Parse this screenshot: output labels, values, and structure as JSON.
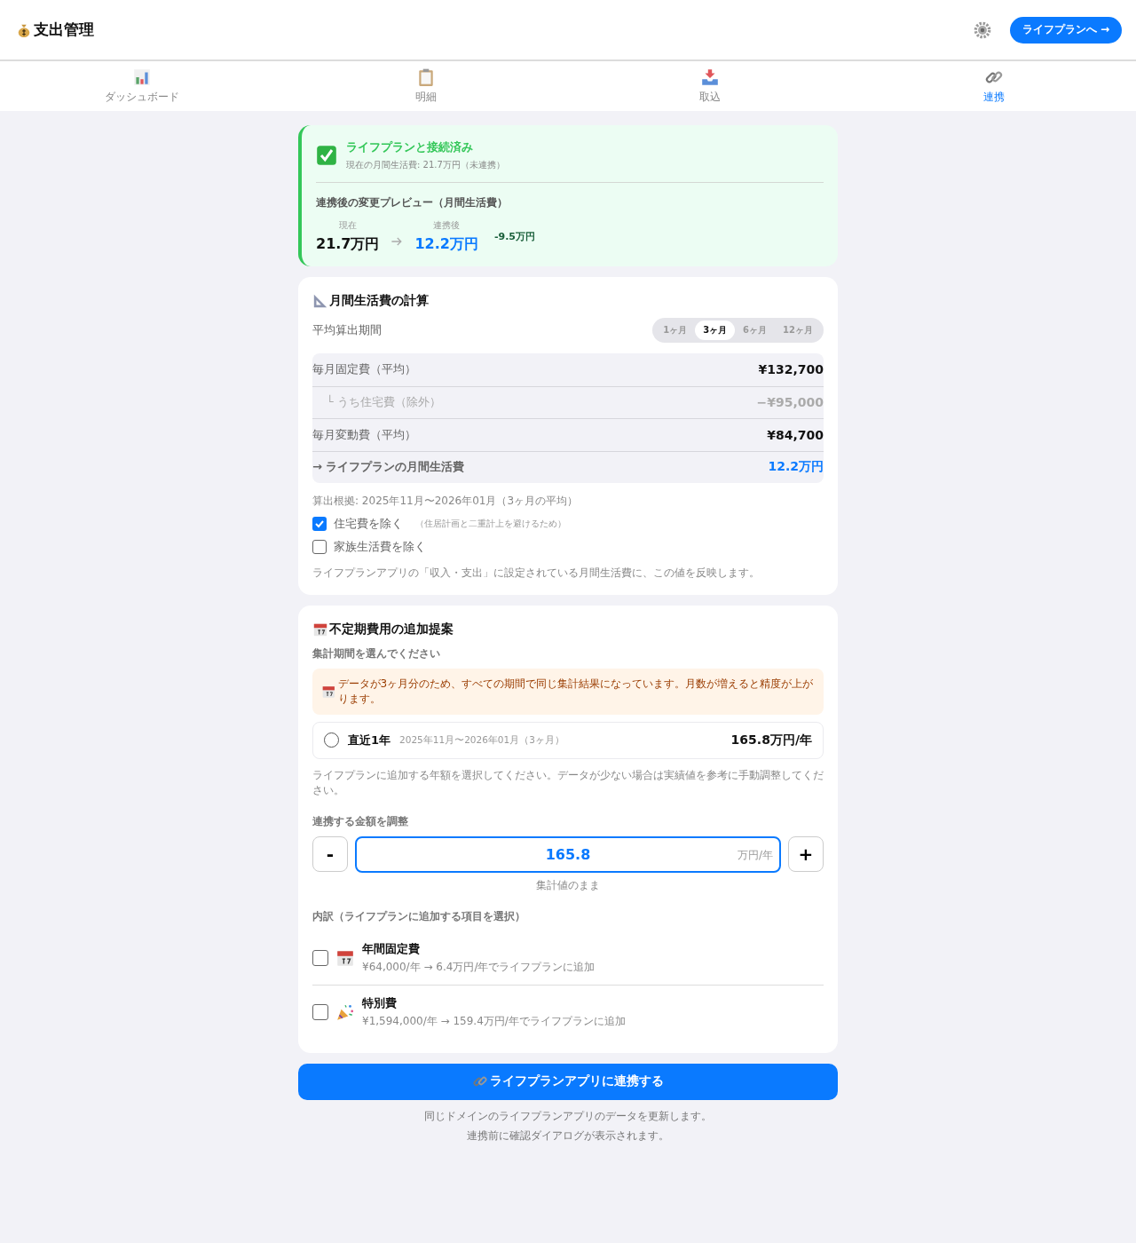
{
  "header": {
    "title": "支出管理",
    "cta": "ライフプランへ →"
  },
  "nav": [
    {
      "label": "ダッシュボード",
      "selected": false
    },
    {
      "label": "明細",
      "selected": false
    },
    {
      "label": "取込",
      "selected": false
    },
    {
      "label": "連携",
      "selected": true
    }
  ],
  "status": {
    "title": "ライフプランと接続済み",
    "subtitle": "現在の月間生活費: 21.7万円（未連携）",
    "preview_title": "連携後の変更プレビュー（月間生活費）",
    "current_label": "現在",
    "current_value": "21.7万円",
    "after_label": "連携後",
    "after_value": "12.2万円",
    "diff": "-9.5万円"
  },
  "calc": {
    "title": "月間生活費の計算",
    "period_label": "平均算出期間",
    "periods": [
      {
        "label": "1ヶ月",
        "selected": false
      },
      {
        "label": "3ヶ月",
        "selected": true
      },
      {
        "label": "6ヶ月",
        "selected": false
      },
      {
        "label": "12ヶ月",
        "selected": false
      }
    ],
    "rows": [
      {
        "kind": "main",
        "label": "毎月固定費（平均）",
        "value": "¥132,700"
      },
      {
        "kind": "sub",
        "label": "└ うち住宅費（除外）",
        "value": "−¥95,000"
      },
      {
        "kind": "main",
        "label": "毎月変動費（平均）",
        "value": "¥84,700"
      },
      {
        "kind": "total",
        "label": "→ ライフプランの月間生活費",
        "value": "12.2万円"
      }
    ],
    "basis": "算出根拠: 2025年11月〜2026年01月（3ヶ月の平均）",
    "options": [
      {
        "label": "住宅費を除く",
        "note": "（住居計画と二重計上を避けるため）",
        "checked": true
      },
      {
        "label": "家族生活費を除く",
        "checked": false
      }
    ],
    "footnote": "ライフプランアプリの「収入・支出」に設定されている月間生活費に、この値を反映します。"
  },
  "irregular": {
    "title": "不定期費用の追加提案",
    "period_heading": "集計期間を選んでください",
    "notice": "データが3ヶ月分のため、すべての期間で同じ集計結果になっています。月数が増えると精度が上がります。",
    "choices": [
      {
        "label": "直近1年",
        "range": "2025年11月〜2026年01月（3ヶ月）",
        "amount": "165.8万円/年",
        "selected": false
      }
    ],
    "choice_hint": "ライフプランに追加する年額を選択してください。データが少ない場合は実績値を参考に手動調整してください。",
    "adjust_heading": "連携する金額を調整",
    "minus": "-",
    "amount": "165.8",
    "unit": "万円/年",
    "plus": "+",
    "amount_note": "集計値のまま",
    "breakdown_heading": "内訳（ライフプランに追加する項目を選択）",
    "items": [
      {
        "kind": "calendar",
        "name": "年間固定費",
        "detail": "¥64,000/年 → 6.4万円/年でライフプランに追加",
        "checked": false
      },
      {
        "kind": "party",
        "name": "特別費",
        "detail": "¥1,594,000/年 → 159.4万円/年でライフプランに追加",
        "checked": false
      }
    ]
  },
  "submit": "ライフプランアプリに連携する",
  "footer": [
    "同じドメインのライフプランアプリのデータを更新します。",
    "連携前に確認ダイアログが表示されます。"
  ]
}
